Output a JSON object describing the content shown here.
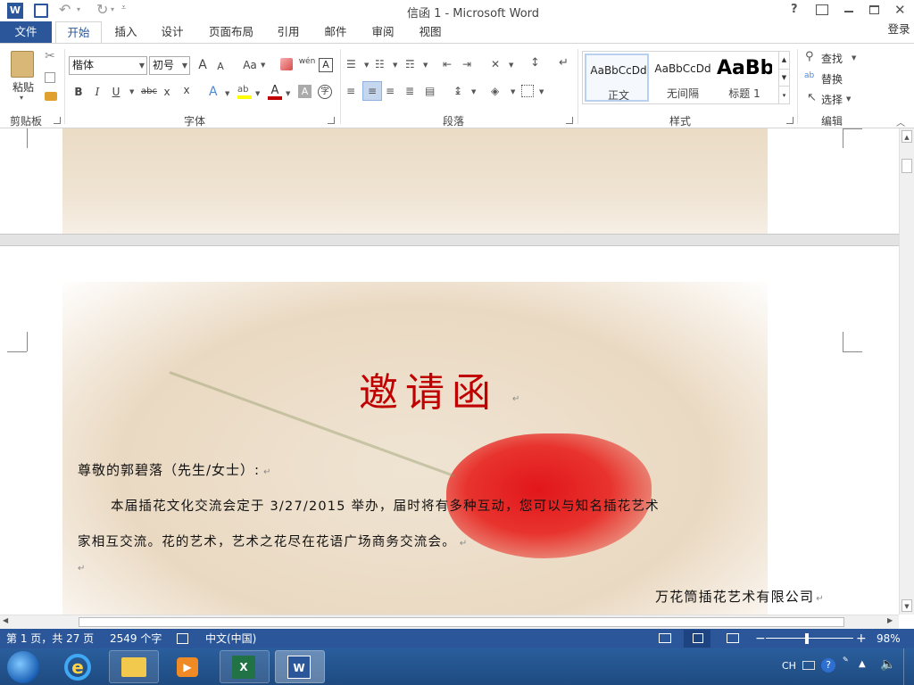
{
  "title_bar": {
    "title": "信函 1 - Microsoft Word",
    "quick_access": [
      "save-icon",
      "undo-icon",
      "redo-icon",
      "customize-icon"
    ],
    "controls": [
      "?",
      "restore-ribbon",
      "minimize",
      "restore",
      "close"
    ]
  },
  "tabs": {
    "file": "文件",
    "items": [
      "开始",
      "插入",
      "设计",
      "页面布局",
      "引用",
      "邮件",
      "审阅",
      "视图"
    ],
    "active": "开始",
    "login": "登录"
  },
  "ribbon": {
    "clipboard": {
      "paste": "粘贴",
      "label": "剪贴板"
    },
    "font": {
      "name": "楷体",
      "size": "初号",
      "grow": "A",
      "shrink": "A",
      "case": "Aa",
      "pinyin": "wén",
      "bold": "B",
      "italic": "I",
      "underline": "U",
      "strike": "abc",
      "sub": "x",
      "sup": "x",
      "label": "字体"
    },
    "paragraph": {
      "label": "段落"
    },
    "styles": {
      "items": [
        {
          "sample": "AaBbCcDd",
          "name": "正文"
        },
        {
          "sample": "AaBbCcDd",
          "name": "无间隔"
        },
        {
          "sample": "AaBb",
          "name": "标题 1"
        }
      ],
      "label": "样式"
    },
    "editing": {
      "find": "查找",
      "replace": "替换",
      "select": "选择",
      "label": "编辑"
    }
  },
  "document": {
    "heading": "邀请函",
    "salutation": "尊敬的郭碧落（先生/女士）:",
    "body_line1": "本届插花文化交流会定于 3/27/2015 举办，届时将有多种互动，您可以与知名插花艺术",
    "body_line2": "家相互交流。花的艺术，艺术之花尽在花语广场商务交流会。",
    "signature": "万花筒插花艺术有限公司",
    "para_mark": "↵"
  },
  "status_bar": {
    "page": "第 1 页，共 27 页",
    "words": "2549 个字",
    "language": "中文(中国)",
    "zoom": "98%"
  },
  "taskbar": {
    "tray_lang": "CH",
    "apps": [
      "ie-icon",
      "explorer-icon",
      "media-player-icon",
      "excel-icon",
      "word-icon"
    ]
  },
  "colors": {
    "accent": "#2b579a",
    "heading": "#c00000"
  }
}
